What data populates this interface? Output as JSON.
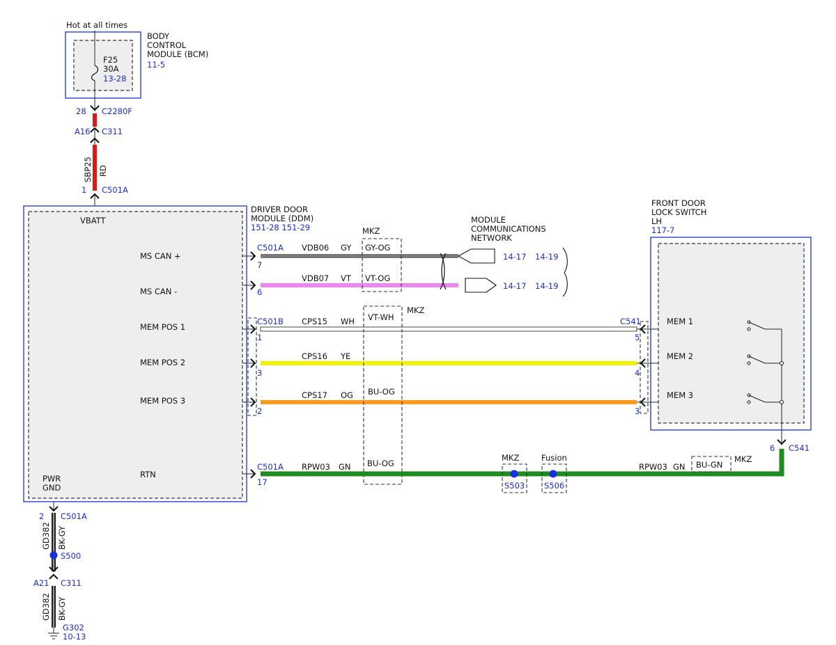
{
  "top": {
    "hot_label": "Hot at all times",
    "bcm": {
      "line1": "BODY",
      "line2": "CONTROL",
      "line3": "MODULE (BCM)",
      "ref": "11-5"
    },
    "fuse": {
      "name": "F25",
      "rating": "30A",
      "ref": "13-28"
    },
    "conn_bcm": {
      "pin": "28",
      "name": "C2280F"
    },
    "conn_c311": {
      "pin": "A16",
      "name": "C311"
    },
    "wire": {
      "circuit": "SBP25",
      "color": "RD"
    },
    "conn_ddm": {
      "pin": "1",
      "name": "C501A"
    }
  },
  "ddm": {
    "title1": "DRIVER DOOR",
    "title2": "MODULE (DDM)",
    "refs": "151-28  151-29",
    "vbatt": "VBATT",
    "pwr": "PWR",
    "gnd": "GND",
    "pins": {
      "ms_can_plus": "MS CAN +",
      "ms_can_minus": "MS CAN -",
      "mem_pos_1": "MEM POS 1",
      "mem_pos_2": "MEM POS 2",
      "mem_pos_3": "MEM POS 3",
      "rtn": "RTN"
    }
  },
  "network": {
    "line1": "MODULE",
    "line2": "COMMUNICATIONS",
    "line3": "NETWORK"
  },
  "wires": {
    "can_plus": {
      "conn": "C501A",
      "pin": "7",
      "circuit": "VDB06",
      "color": "GY",
      "mkz_color": "GY-OG",
      "ref1": "14-17",
      "ref2": "14-19"
    },
    "can_minus": {
      "pin": "6",
      "circuit": "VDB07",
      "color": "VT",
      "mkz_color": "VT-OG",
      "ref1": "14-17",
      "ref2": "14-19"
    },
    "mem1": {
      "conn": "C501B",
      "pin": "1",
      "circuit": "CPS15",
      "color": "WH",
      "mkz_color": "VT-WH",
      "sw_conn": "C541",
      "sw_pin": "5"
    },
    "mem2": {
      "pin": "3",
      "circuit": "CPS16",
      "color": "YE",
      "sw_pin": "4"
    },
    "mem3": {
      "pin": "2",
      "circuit": "CPS17",
      "color": "OG",
      "mkz_color": "BU-OG",
      "sw_pin": "3"
    },
    "rtn": {
      "conn": "C501A",
      "pin": "17",
      "circuit": "RPW03",
      "color": "GN",
      "mkz_color": "BU-OG",
      "circuit_right": "RPW03",
      "color_right": "GN",
      "mkz_color_right": "BU-GN",
      "sw_pin": "6",
      "sw_conn": "C541"
    }
  },
  "mkz_labels": {
    "can": "MKZ",
    "mem": "MKZ",
    "rtn_right": "MKZ",
    "s503": "MKZ",
    "s506": "Fusion"
  },
  "splices": {
    "s503": "S503",
    "s506": "S506"
  },
  "switch": {
    "line1": "FRONT DOOR",
    "line2": "LOCK SWITCH",
    "line3": "LH",
    "ref": "117-7",
    "mem1": "MEM 1",
    "mem2": "MEM 2",
    "mem3": "MEM 3"
  },
  "ground": {
    "conn_ddm": {
      "pin": "2",
      "name": "C501A"
    },
    "wire1": {
      "circuit": "GD382",
      "color": "BK-GY"
    },
    "splice": "S500",
    "conn_c311": {
      "pin": "A21",
      "name": "C311"
    },
    "wire2": {
      "circuit": "GD382",
      "color": "BK-GY"
    },
    "g": {
      "name": "G302",
      "ref": "10-13"
    }
  },
  "colors": {
    "red": "#e01818",
    "gray": "#7a7a7a",
    "violet": "#ee88ee",
    "white": "#ffffff",
    "yellow": "#f2f200",
    "orange": "#ff9a1a",
    "green": "#1f8a1f",
    "black": "#222222",
    "splice_blue": "#1a2ee0"
  }
}
